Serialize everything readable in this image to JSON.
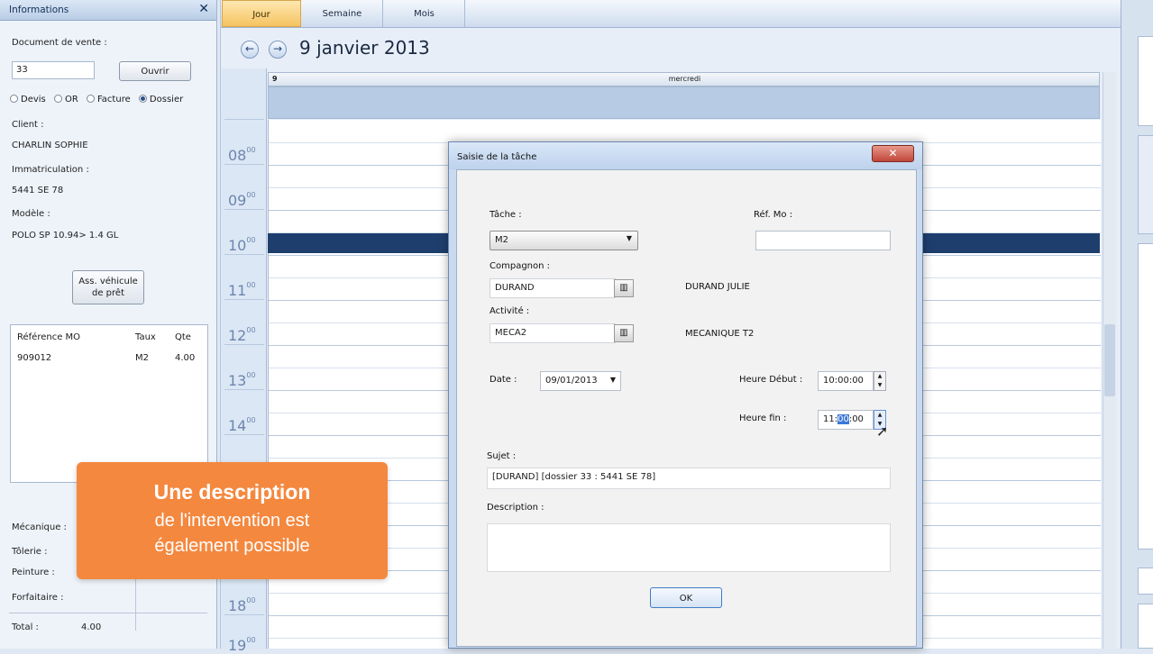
{
  "left_panel": {
    "title": "Informations",
    "close_glyph": "✕",
    "doc_label": "Document de vente :",
    "doc_value": "33",
    "open_button": "Ouvrir",
    "radios": [
      "Devis",
      "OR",
      "Facture",
      "Dossier"
    ],
    "radio_selected": "Dossier",
    "client_label": "Client :",
    "client_value": "CHARLIN SOPHIE",
    "immat_label": "Immatriculation :",
    "immat_value": "5441 SE 78",
    "model_label": "Modèle :",
    "model_value": "POLO SP 10.94> 1.4 GL",
    "loan_button": [
      "Ass. véhicule",
      "de prêt"
    ],
    "table": {
      "headers": [
        "Référence MO",
        "Taux",
        "Qte"
      ],
      "rows": [
        [
          "909012",
          "M2",
          "4.00"
        ]
      ]
    },
    "totals": {
      "mecanique": "Mécanique :",
      "tolerie": "Tôlerie :",
      "peinture": "Peinture :",
      "forfaitaire": "Forfaitaire :",
      "total_label": "Total :",
      "total_value": "4.00"
    }
  },
  "calendar": {
    "tabs": [
      "Jour",
      "Semaine",
      "Mois"
    ],
    "active_tab": "Jour",
    "date_title": "9 janvier 2013",
    "day_number": "9",
    "day_name": "mercredi",
    "hours": [
      "08",
      "09",
      "10",
      "11",
      "12",
      "13",
      "14",
      "18",
      "19"
    ],
    "minutes": "00"
  },
  "dialog": {
    "title": "Saisie de la tâche",
    "close_glyph": "✕",
    "tache_label": "Tâche :",
    "tache_value": "M2",
    "ref_mo_label": "Réf. Mo :",
    "ref_mo_value": "",
    "compagnon_label": "Compagnon :",
    "compagnon_value": "DURAND",
    "compagnon_name": "DURAND JULIE",
    "activite_label": "Activité :",
    "activite_value": "MECA2",
    "activite_name": "MECANIQUE T2",
    "date_label": "Date :",
    "date_value": "09/01/2013",
    "heure_debut_label": "Heure Début :",
    "heure_debut_value": "10:00:00",
    "heure_fin_label": "Heure fin :",
    "heure_fin_h": "11:",
    "heure_fin_sel": "00",
    "heure_fin_s": ":00",
    "sujet_label": "Sujet :",
    "sujet_value": "[DURAND] [dossier 33 : 5441 SE 78]",
    "description_label": "Description :",
    "description_value": "",
    "ok_button": "OK"
  },
  "callout": {
    "line1": "Une description",
    "line2": "de l'intervention est",
    "line3": "également possible",
    "color": "#f4883f"
  },
  "colors": {
    "appointment": "#1e3f6e",
    "active_tab": "#f6c361"
  }
}
